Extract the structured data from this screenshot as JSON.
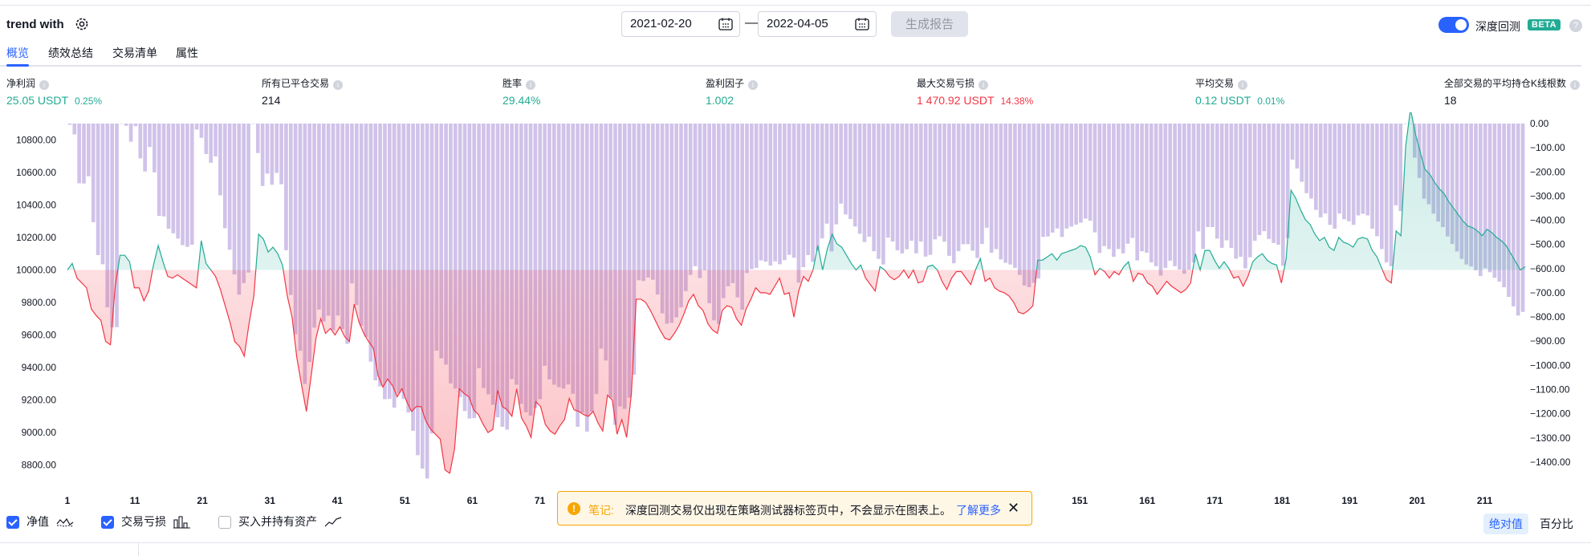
{
  "header": {
    "strategy_name": "trend with",
    "date_from": "2021-02-20",
    "date_sep": "—",
    "date_to": "2022-04-05",
    "generate_label": "生成报告",
    "deep_backtest_label": "深度回测",
    "beta_label": "BETA",
    "help": "?"
  },
  "tabs": [
    {
      "label": "概览",
      "active": true
    },
    {
      "label": "绩效总结",
      "active": false
    },
    {
      "label": "交易清单",
      "active": false
    },
    {
      "label": "属性",
      "active": false
    }
  ],
  "metrics": [
    {
      "label": "净利润",
      "value": "25.05 USDT",
      "pct": "0.25%",
      "color": "green"
    },
    {
      "label": "所有已平仓交易",
      "value": "214",
      "pct": "",
      "color": "dark"
    },
    {
      "label": "胜率",
      "value": "29.44%",
      "pct": "",
      "color": "green"
    },
    {
      "label": "盈利因子",
      "value": "1.002",
      "pct": "",
      "color": "green"
    },
    {
      "label": "最大交易亏损",
      "value": "1 470.92 USDT",
      "pct": "14.38%",
      "color": "red"
    },
    {
      "label": "平均交易",
      "value": "0.12 USDT",
      "pct": "0.01%",
      "color": "green"
    },
    {
      "label": "全部交易的平均持仓K线根数",
      "value": "18",
      "pct": "",
      "color": "dark"
    }
  ],
  "chart_data": {
    "type": "line",
    "x_ticks": [
      "1",
      "11",
      "21",
      "31",
      "41",
      "51",
      "61",
      "71",
      "151",
      "161",
      "171",
      "181",
      "191",
      "201",
      "211"
    ],
    "y_left_ticks": [
      "10800.00",
      "10600.00",
      "10400.00",
      "10200.00",
      "10000.00",
      "9800.00",
      "9600.00",
      "9400.00",
      "9200.00",
      "9000.00",
      "8800.00"
    ],
    "y_right_ticks": [
      "0.00",
      "−100.00",
      "−200.00",
      "−300.00",
      "−400.00",
      "−500.00",
      "−600.00",
      "−700.00",
      "−800.00",
      "−900.00",
      "−1000.00",
      "−1100.00",
      "−1200.00",
      "−1300.00",
      "−1400.00"
    ],
    "y_left_range": [
      8700,
      10900
    ],
    "y_right_range": [
      -1480,
      0
    ],
    "baseline": 10000,
    "equity": [
      10000,
      10040,
      9950,
      9920,
      9890,
      9760,
      9720,
      9690,
      9560,
      9540,
      9900,
      10090,
      10090,
      10050,
      9890,
      9890,
      9810,
      9870,
      10030,
      10150,
      10050,
      9960,
      9950,
      9970,
      9950,
      9930,
      9910,
      9890,
      10180,
      10040,
      10000,
      9960,
      9880,
      9780,
      9680,
      9560,
      9530,
      9470,
      9670,
      9840,
      10220,
      10190,
      10110,
      10140,
      10100,
      10030,
      9840,
      9710,
      9460,
      9290,
      9130,
      9350,
      9580,
      9700,
      9610,
      9640,
      9600,
      9650,
      9590,
      9560,
      9790,
      9680,
      9610,
      9560,
      9520,
      9350,
      9280,
      9330,
      9290,
      9220,
      9270,
      9190,
      9130,
      9160,
      9160,
      9070,
      9020,
      8990,
      8960,
      8770,
      8750,
      8900,
      9270,
      9240,
      9220,
      9140,
      9110,
      9050,
      9000,
      9020,
      9260,
      9160,
      9140,
      9100,
      9270,
      9090,
      9040,
      8970,
      9190,
      9160,
      9050,
      9010,
      8990,
      9040,
      9080,
      9210,
      9140,
      9130,
      9110,
      9100,
      9130,
      9060,
      9010,
      9230,
      9200,
      8990,
      9080,
      8970,
      9240,
      9820,
      9820,
      9800,
      9750,
      9690,
      9630,
      9580,
      9570,
      9610,
      9660,
      9730,
      9810,
      9850,
      9780,
      9750,
      9670,
      9630,
      9610,
      9750,
      9780,
      9770,
      9700,
      9660,
      9760,
      9820,
      9890,
      9860,
      9860,
      9850,
      9900,
      9950,
      9850,
      9860,
      9710,
      9870,
      9960,
      9930,
      10000,
      10150,
      10000,
      10130,
      10220,
      10160,
      10140,
      10090,
      10040,
      10000,
      10030,
      9950,
      9910,
      9870,
      10020,
      10000,
      9960,
      9940,
      9960,
      10000,
      9950,
      10000,
      9920,
      9930,
      10020,
      10030,
      10000,
      9930,
      9880,
      9950,
      9990,
      9990,
      9950,
      9910,
      10000,
      10070,
      9930,
      9950,
      9890,
      9870,
      9860,
      9840,
      9800,
      9740,
      9730,
      9750,
      9780,
      10060,
      10060,
      10080,
      10100,
      10060,
      10100,
      10110,
      10120,
      10130,
      10150,
      10140,
      10080,
      9970,
      10010,
      9990,
      9950,
      9990,
      9970,
      10020,
      10050,
      9930,
      9980,
      9970,
      9920,
      9900,
      9850,
      9890,
      9930,
      9900,
      9880,
      9860,
      9880,
      9920,
      10100,
      10000,
      10120,
      10120,
      10060,
      10010,
      10050,
      10010,
      9950,
      9960,
      9900,
      9960,
      10050,
      10080,
      10100,
      10060,
      10040,
      10030,
      9920,
      10070,
      10490,
      10440,
      10370,
      10310,
      10280,
      10220,
      10180,
      10200,
      10140,
      10120,
      10200,
      10170,
      10160,
      10140,
      10190,
      10200,
      10190,
      10120,
      10080,
      10010,
      9940,
      9920,
      10240,
      10210,
      10760,
      10990,
      10840,
      10730,
      10620,
      10590,
      10540,
      10500,
      10470,
      10420,
      10380,
      10340,
      10300,
      10270,
      10260,
      10240,
      10210,
      10250,
      10230,
      10200,
      10180,
      10150,
      10100,
      10050,
      10000,
      10020
    ],
    "buy_hold": [],
    "bars_drawdown": [
      -5,
      -45,
      -247,
      -248,
      -218,
      -408,
      -544,
      -582,
      -760,
      -843,
      -842,
      -1,
      -9,
      -75,
      -11,
      -144,
      -198,
      -97,
      -202,
      -382,
      -384,
      -435,
      -454,
      -476,
      -503,
      -510,
      -501,
      -25,
      -59,
      -126,
      -162,
      -136,
      -297,
      -433,
      -522,
      -624,
      -708,
      -660,
      -616,
      -1,
      -122,
      -258,
      -207,
      -253,
      -204,
      -251,
      -524,
      -709,
      -872,
      -940,
      -1077,
      -986,
      -844,
      -769,
      -819,
      -795,
      -855,
      -794,
      -851,
      -911,
      -661,
      -751,
      -837,
      -882,
      -985,
      -1062,
      -1087,
      -1140,
      -1139,
      -1175,
      -1115,
      -1139,
      -1195,
      -1271,
      -1372,
      -1427,
      -1468,
      -1282,
      -939,
      -971,
      -997,
      -1075,
      -1096,
      -1132,
      -1189,
      -1220,
      -1218,
      -1012,
      -1094,
      -1120,
      -1163,
      -1215,
      -1254,
      -1266,
      -1057,
      -1080,
      -1159,
      -1194,
      -1208,
      -1177,
      -1140,
      -1002,
      -1058,
      -1080,
      -1090,
      -1096,
      -1079,
      -1118,
      -1254,
      -1196,
      -1274,
      -1192,
      -1119,
      -931,
      -980,
      -1134,
      -1246,
      -1170,
      -1180,
      -1134,
      -1039,
      -648,
      -651,
      -637,
      -646,
      -707,
      -785,
      -828,
      -824,
      -802,
      -760,
      -693,
      -626,
      -590,
      -639,
      -607,
      -743,
      -814,
      -829,
      -722,
      -673,
      -660,
      -719,
      -770,
      -618,
      -602,
      -597,
      -566,
      -571,
      -587,
      -570,
      -582,
      -565,
      -543,
      -555,
      -658,
      -594,
      -544,
      -572,
      -526,
      -475,
      -414,
      -529,
      -417,
      -331,
      -376,
      -395,
      -426,
      -456,
      -490,
      -468,
      -528,
      -560,
      -583,
      -472,
      -488,
      -524,
      -537,
      -520,
      -485,
      -537,
      -488,
      -550,
      -543,
      -479,
      -466,
      -489,
      -547,
      -578,
      -528,
      -499,
      -499,
      -526,
      -556,
      -498,
      -431,
      -534,
      -519,
      -562,
      -576,
      -583,
      -597,
      -626,
      -670,
      -677,
      -659,
      -641,
      -469,
      -467,
      -451,
      -434,
      -469,
      -434,
      -426,
      -418,
      -410,
      -393,
      -402,
      -450,
      -535,
      -507,
      -519,
      -551,
      -519,
      -537,
      -497,
      -473,
      -566,
      -528,
      -534,
      -574,
      -590,
      -629,
      -597,
      -567,
      -590,
      -604,
      -621,
      -605,
      -574,
      -446,
      -519,
      -428,
      -428,
      -476,
      -514,
      -483,
      -514,
      -559,
      -551,
      -599,
      -553,
      -485,
      -461,
      -445,
      -477,
      -494,
      -501,
      -588,
      -474,
      -149,
      -186,
      -241,
      -288,
      -310,
      -357,
      -388,
      -372,
      -419,
      -435,
      -372,
      -396,
      -404,
      -419,
      -380,
      -373,
      -380,
      -435,
      -466,
      -519,
      -574,
      -590,
      -338,
      -362,
      0,
      0,
      -141,
      -225,
      -311,
      -334,
      -373,
      -405,
      -428,
      -467,
      -498,
      -529,
      -560,
      -583,
      -591,
      -607,
      -631,
      -599,
      -615,
      -638,
      -654,
      -677,
      -717,
      -756,
      -794,
      -779
    ]
  },
  "legend": {
    "equity_label": "净值",
    "trades_label": "交易亏损",
    "buyhold_label": "买入并持有资产"
  },
  "notice": {
    "icon": "!",
    "title": "笔记:",
    "text": "深度回测交易仅出现在策略测试器标签页中，不会显示在图表上。",
    "link": "了解更多",
    "close": "✕"
  },
  "view_toggle": {
    "absolute": "绝对值",
    "percent": "百分比"
  },
  "colors": {
    "accent": "#2962ff",
    "positive": "#22ab94",
    "negative": "#f23645",
    "bar": "#b39ddb",
    "warning": "#f7a600"
  }
}
